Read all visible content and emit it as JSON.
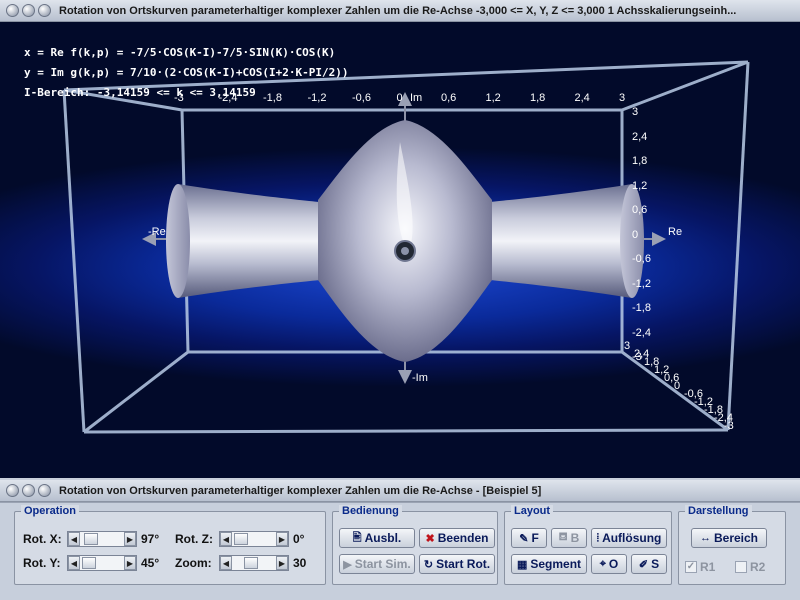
{
  "window": {
    "top_title": "Rotation von Ortskurven parameterhaltiger komplexer Zahlen um die Re-Achse    -3,000 <= X, Y, Z <= 3,000     1 Achsskalierungseinh...",
    "bottom_title": "Rotation von Ortskurven parameterhaltiger komplexer Zahlen um die Re-Achse - [Beispiel 5]"
  },
  "plot": {
    "formula_x": "x = Re f(k,p) = -7/5·COS(K-I)-7/5·SIN(K)·COS(K)",
    "formula_y": "y = Im g(k,p) = 7/10·(2·COS(K-I)+COS(I+2·K-PI/2))",
    "formula_range": "I-Bereich: -3,14159 <= k <= 3,14159",
    "axis_labels": {
      "im": "Im",
      "neg_im": "-Im",
      "re": "Re",
      "neg_re": "-Re"
    },
    "top_ticks": [
      "-3",
      "-2,4",
      "-1,8",
      "-1,2",
      "-0,6",
      "0",
      "0,6",
      "1,2",
      "1,8",
      "2,4",
      "3"
    ],
    "right_ticks": [
      "3",
      "2,4",
      "1,8",
      "1,2",
      "0,6",
      "0",
      "-0,6",
      "-1,2",
      "-1,8",
      "-2,4",
      "-3"
    ],
    "depth_ticks": [
      "3",
      "2,4",
      "1,8",
      "1,2",
      "0,6",
      "0",
      "-0,6",
      "-1,2",
      "-1,8",
      "-2,4",
      "-3"
    ]
  },
  "controls": {
    "operation": {
      "legend": "Operation",
      "rot_x_label": "Rot. X:",
      "rot_x_value": "97°",
      "rot_y_label": "Rot. Y:",
      "rot_y_value": "45°",
      "rot_z_label": "Rot. Z:",
      "rot_z_value": "0°",
      "zoom_label": "Zoom:",
      "zoom_value": "30"
    },
    "bedienung": {
      "legend": "Bedienung",
      "ausbl": "Ausbl.",
      "beenden": "Beenden",
      "start_sim": "Start Sim.",
      "start_rot": "Start Rot."
    },
    "layout": {
      "legend": "Layout",
      "f": "F",
      "b": "B",
      "aufloesung": "Auflösung",
      "segment": "Segment",
      "o": "O",
      "s": "S"
    },
    "darstellung": {
      "legend": "Darstellung",
      "bereich": "Bereich",
      "r1": "R1",
      "r2": "R2"
    }
  }
}
